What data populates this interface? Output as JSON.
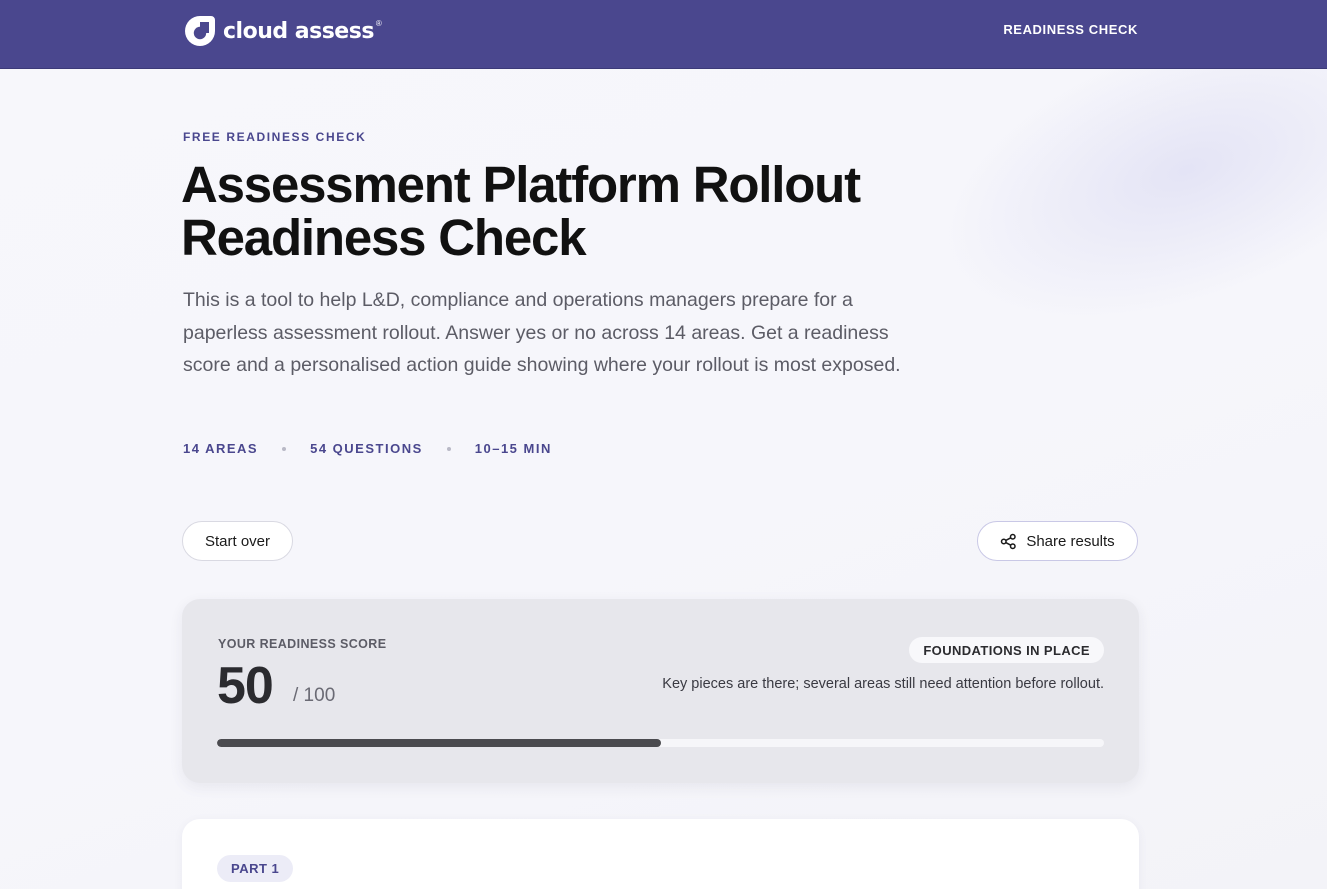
{
  "header": {
    "logo_text": "cloud assess",
    "logo_reg": "®",
    "nav_link": "READINESS CHECK",
    "bg_color": "#4a478e"
  },
  "hero": {
    "eyebrow": "FREE READINESS CHECK",
    "title_line1": "Assessment Platform Rollout",
    "title_line2": "Readiness Check",
    "lead": "This is a tool to help L&D, compliance and operations managers prepare for a paperless assessment rollout. Answer yes or no across 14 areas. Get a readiness score and a personalised action guide showing where your rollout is most exposed.",
    "meta": [
      "14 AREAS",
      "54 QUESTIONS",
      "10–15 MIN"
    ]
  },
  "actions": {
    "start_over": "Start over",
    "share": "Share results",
    "share_icon": "share-icon"
  },
  "score": {
    "label": "YOUR READINESS SCORE",
    "value": "50",
    "max_text": "/ 100",
    "progress_fraction": 0.5,
    "level": "FOUNDATIONS IN PLACE",
    "description": "Key pieces are there; several areas still need attention before rollout."
  },
  "part": {
    "badge": "PART 1"
  }
}
